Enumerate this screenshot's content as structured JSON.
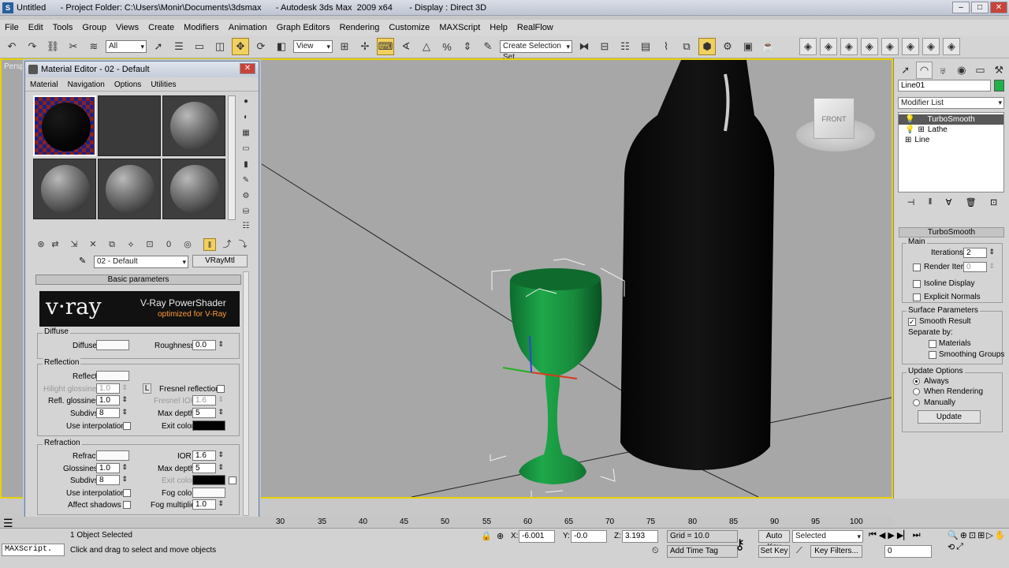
{
  "window": {
    "title": "Untitled      - Project Folder: C:\\Users\\Monir\\Documents\\3dsmax      - Autodesk 3ds Max  2009 x64       - Display : Direct 3D",
    "app_icon": "3ds-max-icon"
  },
  "menubar": [
    "File",
    "Edit",
    "Tools",
    "Group",
    "Views",
    "Create",
    "Modifiers",
    "Animation",
    "Graph Editors",
    "Rendering",
    "Customize",
    "MAXScript",
    "Help",
    "RealFlow"
  ],
  "toolbar": {
    "filter_value": "All",
    "refcoord_value": "View",
    "named_selection_placeholder": "Create Selection Set"
  },
  "viewport": {
    "label": "Perspective",
    "viewcube_label": "FRONT"
  },
  "command_panel": {
    "object_name": "Line01",
    "object_color": "#1fb14a",
    "modifier_list_label": "Modifier List",
    "stack": [
      "TurboSmooth",
      "Lathe",
      "Line"
    ],
    "rollout_title": "TurboSmooth",
    "main_group": "Main",
    "iterations_label": "Iterations:",
    "iterations_value": "2",
    "render_iters_label": "Render Iters:",
    "render_iters_value": "0",
    "isoline_label": "Isoline Display",
    "explicit_normals_label": "Explicit Normals",
    "surface_group": "Surface Parameters",
    "smooth_result_label": "Smooth Result",
    "separate_by_label": "Separate by:",
    "materials_label": "Materials",
    "smoothing_groups_label": "Smoothing Groups",
    "update_group": "Update Options",
    "always_label": "Always",
    "when_rendering_label": "When Rendering",
    "manually_label": "Manually",
    "update_button": "Update"
  },
  "material_editor": {
    "title": "Material Editor - 02 - Default",
    "menu": [
      "Material",
      "Navigation",
      "Options",
      "Utilities"
    ],
    "material_name": "02 - Default",
    "material_type": "VRayMtl",
    "rollout_title": "Basic parameters",
    "vray_logo": "v·ray",
    "vray_banner_title": "V-Ray PowerShader",
    "vray_banner_sub": "optimized for V-Ray",
    "diffuse_section": "Diffuse",
    "diffuse_label": "Diffuse",
    "roughness_label": "Roughness",
    "roughness_value": "0.0",
    "reflection_section": "Reflection",
    "reflect_label": "Reflect",
    "hilight_gloss_label": "Hilight glossiness",
    "hilight_gloss_value": "1.0",
    "lock_label": "L",
    "fresnel_label": "Fresnel reflections",
    "refl_gloss_label": "Refl. glossiness",
    "refl_gloss_value": "1.0",
    "fresnel_ior_label": "Fresnel IOR",
    "fresnel_ior_value": "1.6",
    "subdivs_label": "Subdivs",
    "subdivs_value": "8",
    "max_depth_label": "Max depth",
    "max_depth_value": "5",
    "use_interp_label": "Use interpolation",
    "exit_color_label": "Exit color",
    "refraction_section": "Refraction",
    "refract_label": "Refract",
    "ior_label": "IOR",
    "ior_value": "1.6",
    "glossiness_label": "Glossiness",
    "glossiness_value": "1.0",
    "r_max_depth_value": "5",
    "r_subdivs_value": "8",
    "r_exit_color_label": "Exit color",
    "fog_color_label": "Fog color",
    "affect_shadows_label": "Affect shadows",
    "fog_mult_label": "Fog multiplier",
    "fog_mult_value": "1.0"
  },
  "timeline": {
    "ticks": [
      "30",
      "35",
      "40",
      "45",
      "50",
      "55",
      "60",
      "65",
      "70",
      "75",
      "80",
      "85",
      "90",
      "95",
      "100"
    ]
  },
  "status": {
    "maxscript_label": "MAXScript.",
    "selection_text": "1 Object Selected",
    "prompt_text": "Click and drag to select and move objects",
    "x_label": "X:",
    "x_value": "-6.001",
    "y_label": "Y:",
    "y_value": "-0.0",
    "z_label": "Z:",
    "z_value": "3.193",
    "grid_text": "Grid = 10.0",
    "add_time_tag": "Add Time Tag",
    "auto_key": "Auto Key",
    "set_key": "Set Key",
    "key_mode_value": "Selected",
    "key_filters": "Key Filters...",
    "frame_value": "0"
  }
}
